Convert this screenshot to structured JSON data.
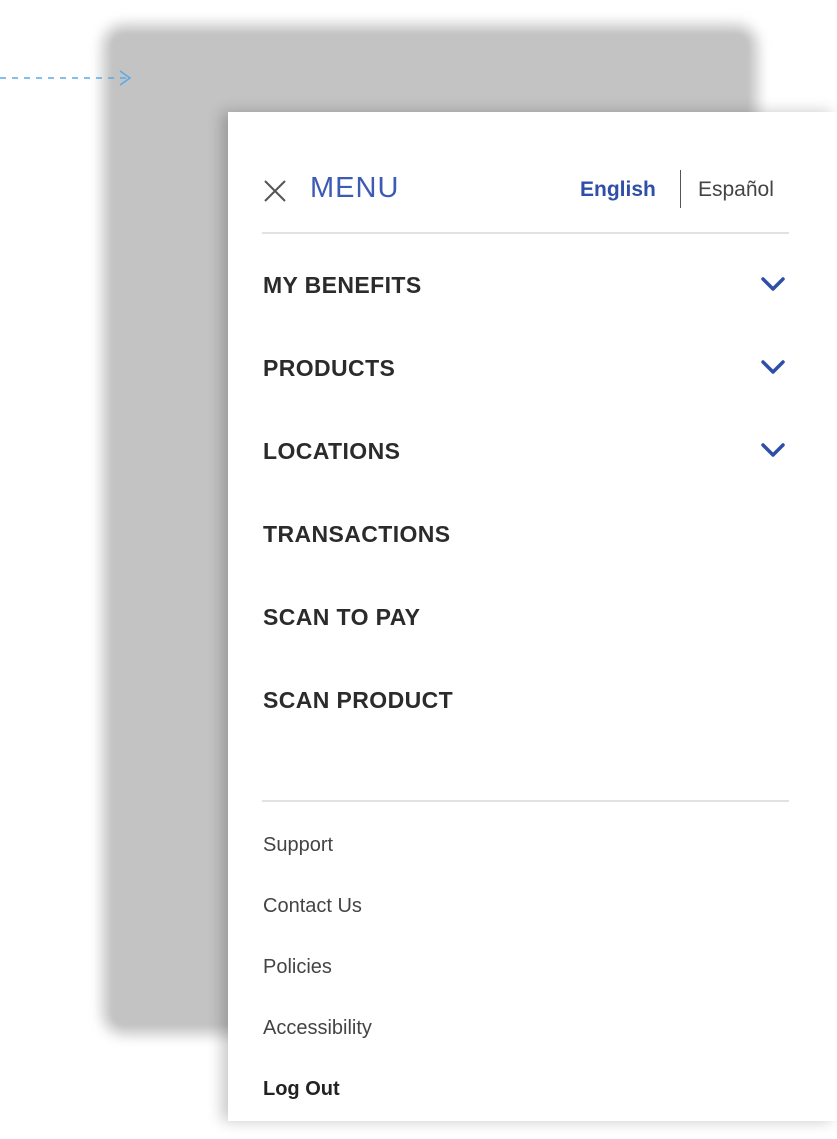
{
  "menu": {
    "title": "MENU",
    "language": {
      "active": "English",
      "alternate": "Español"
    },
    "primary_items": [
      {
        "label": "MY BENEFITS",
        "has_chevron": true
      },
      {
        "label": "PRODUCTS",
        "has_chevron": true
      },
      {
        "label": "LOCATIONS",
        "has_chevron": true
      },
      {
        "label": "TRANSACTIONS",
        "has_chevron": false
      },
      {
        "label": "SCAN TO PAY",
        "has_chevron": false
      },
      {
        "label": "SCAN PRODUCT",
        "has_chevron": false
      }
    ],
    "secondary_items": [
      {
        "label": "Support",
        "emphasis": false
      },
      {
        "label": "Contact Us",
        "emphasis": false
      },
      {
        "label": "Policies",
        "emphasis": false
      },
      {
        "label": "Accessibility",
        "emphasis": false
      },
      {
        "label": "Log Out",
        "emphasis": true
      }
    ]
  },
  "icons": {
    "close": "close-icon",
    "chevron": "chevron-down-icon",
    "annotation": "dashed-arrow-icon"
  },
  "colors": {
    "accent": "#2f4ea8",
    "title": "#3d5bb4",
    "annotation": "#5aa9e6",
    "backdrop": "#c3c3c3"
  }
}
